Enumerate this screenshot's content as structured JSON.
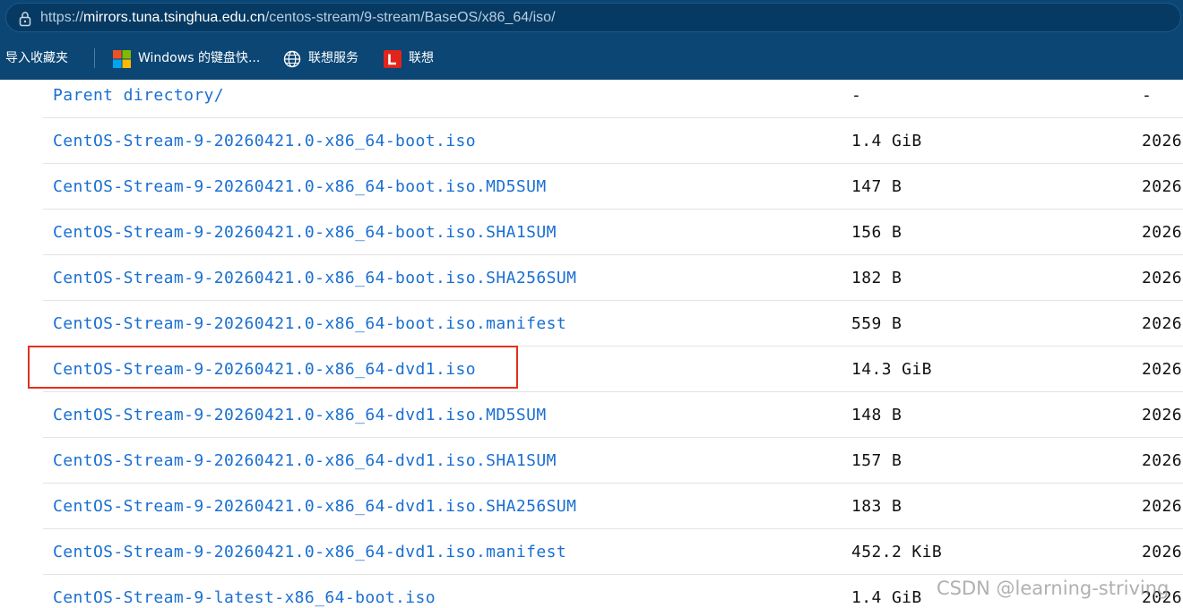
{
  "address_bar": {
    "scheme": "https://",
    "host": "mirrors.tuna.tsinghua.edu.cn",
    "path": "/centos-stream/9-stream/BaseOS/x86_64/iso/"
  },
  "bookmarks": {
    "import": "导入收藏夹",
    "items": [
      {
        "label": "Windows 的键盘快...",
        "icon": "windows-logo-icon"
      },
      {
        "label": "联想服务",
        "icon": "globe-icon"
      },
      {
        "label": "联想",
        "icon": "lenovo-logo-icon"
      }
    ]
  },
  "files": [
    {
      "name": "Parent directory/",
      "size": "-",
      "date": "-"
    },
    {
      "name": "CentOS-Stream-9-20260421.0-x86_64-boot.iso",
      "size": "1.4 GiB",
      "date": "2026"
    },
    {
      "name": "CentOS-Stream-9-20260421.0-x86_64-boot.iso.MD5SUM",
      "size": "147 B",
      "date": "2026"
    },
    {
      "name": "CentOS-Stream-9-20260421.0-x86_64-boot.iso.SHA1SUM",
      "size": "156 B",
      "date": "2026"
    },
    {
      "name": "CentOS-Stream-9-20260421.0-x86_64-boot.iso.SHA256SUM",
      "size": "182 B",
      "date": "2026"
    },
    {
      "name": "CentOS-Stream-9-20260421.0-x86_64-boot.iso.manifest",
      "size": "559 B",
      "date": "2026"
    },
    {
      "name": "CentOS-Stream-9-20260421.0-x86_64-dvd1.iso",
      "size": "14.3 GiB",
      "date": "2026"
    },
    {
      "name": "CentOS-Stream-9-20260421.0-x86_64-dvd1.iso.MD5SUM",
      "size": "148 B",
      "date": "2026"
    },
    {
      "name": "CentOS-Stream-9-20260421.0-x86_64-dvd1.iso.SHA1SUM",
      "size": "157 B",
      "date": "2026"
    },
    {
      "name": "CentOS-Stream-9-20260421.0-x86_64-dvd1.iso.SHA256SUM",
      "size": "183 B",
      "date": "2026"
    },
    {
      "name": "CentOS-Stream-9-20260421.0-x86_64-dvd1.iso.manifest",
      "size": "452.2 KiB",
      "date": "2026"
    },
    {
      "name": "CentOS-Stream-9-latest-x86_64-boot.iso",
      "size": "1.4 GiB",
      "date": "2026"
    }
  ],
  "watermark": "CSDN @learning-striving",
  "colors": {
    "chrome": "#0b4675",
    "link": "#1a6fd1",
    "highlight_box": "#e0321c"
  }
}
